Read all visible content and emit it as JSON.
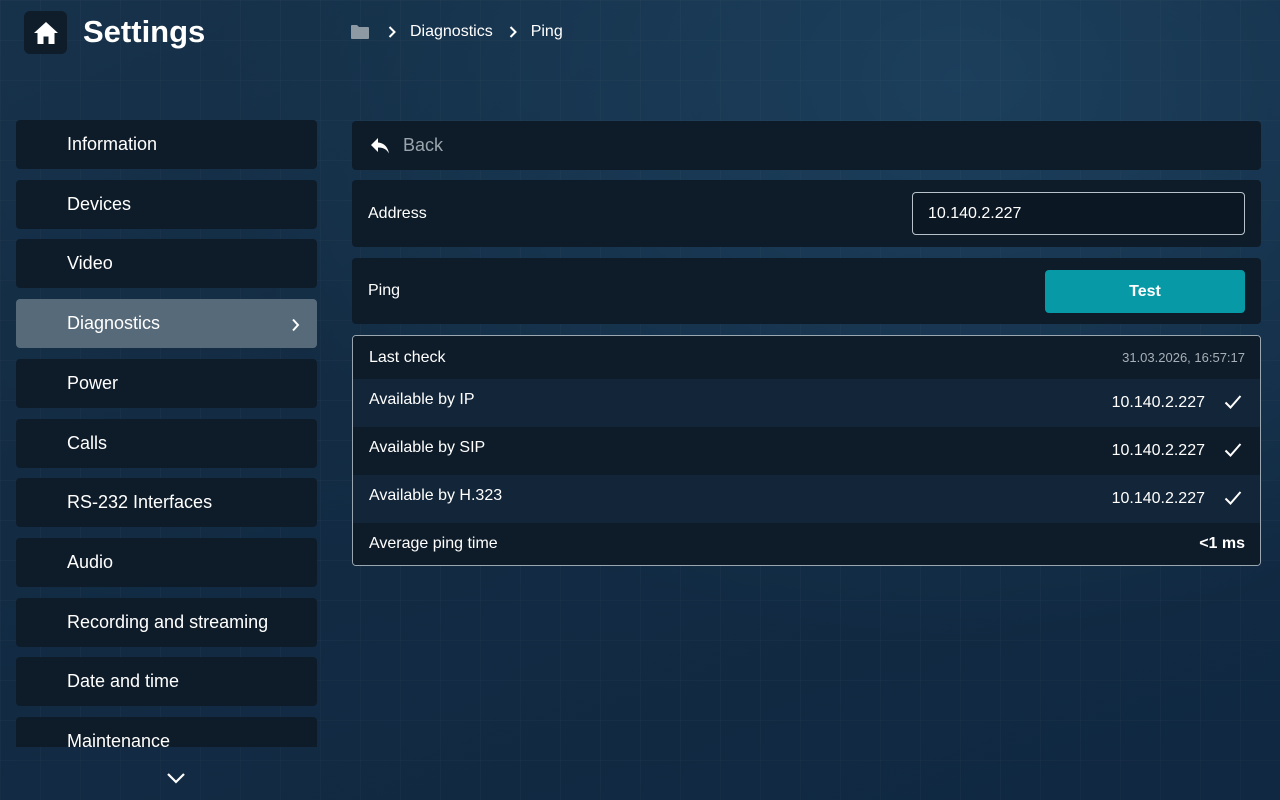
{
  "header": {
    "title": "Settings",
    "home_icon": "home-icon"
  },
  "breadcrumb": {
    "root_icon": "folder-icon",
    "items": [
      "Diagnostics",
      "Ping"
    ]
  },
  "sidebar": {
    "items": [
      {
        "label": "Information"
      },
      {
        "label": "Devices"
      },
      {
        "label": "Video"
      },
      {
        "label": "Diagnostics",
        "active": true
      },
      {
        "label": "Power"
      },
      {
        "label": "Calls"
      },
      {
        "label": "RS-232 Interfaces"
      },
      {
        "label": "Audio"
      },
      {
        "label": "Recording and streaming"
      },
      {
        "label": "Date and time"
      },
      {
        "label": "Maintenance"
      }
    ],
    "scroll_icon": "chevron-down-icon"
  },
  "main": {
    "back_label": "Back",
    "address": {
      "label": "Address",
      "value": "10.140.2.227"
    },
    "ping": {
      "label": "Ping",
      "button": "Test"
    },
    "results": {
      "last_check_label": "Last check",
      "last_check_time": "31.03.2026, 16:57:17",
      "rows": [
        {
          "label": "Available by IP",
          "value": "10.140.2.227",
          "ok": true
        },
        {
          "label": "Available by SIP",
          "value": "10.140.2.227",
          "ok": true
        },
        {
          "label": "Available by H.323",
          "value": "10.140.2.227",
          "ok": true
        }
      ],
      "avg_label": "Average ping time",
      "avg_value": "<1 ms"
    }
  },
  "colors": {
    "accent": "#0899a6",
    "active_item": "#566a79",
    "panel": "#0e1c29"
  }
}
